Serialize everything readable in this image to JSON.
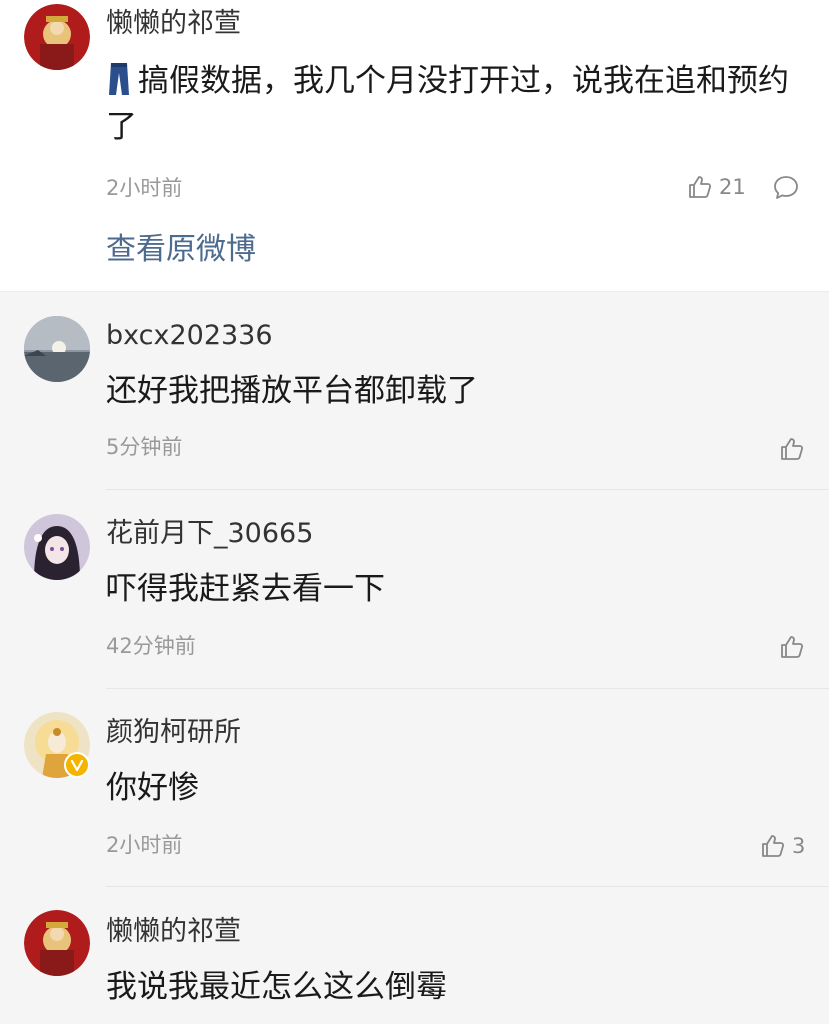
{
  "main_comment": {
    "username": "懒懒的祁萱",
    "emoji_icon": "jeans-icon",
    "text": "搞假数据，我几个月没打开过，说我在追和预约了",
    "time": "2小时前",
    "like_count": "21",
    "view_original_label": "查看原微博"
  },
  "replies": [
    {
      "username": "bxcx202336",
      "text": "还好我把播放平台都卸载了",
      "time": "5分钟前",
      "like_count": ""
    },
    {
      "username": "花前月下_30665",
      "text": "吓得我赶紧去看一下",
      "time": "42分钟前",
      "like_count": ""
    },
    {
      "username": "颜狗柯研所",
      "text": "你好惨",
      "time": "2小时前",
      "like_count": "3",
      "verified": true
    },
    {
      "username": "懒懒的祁萱",
      "text": "我说我最近怎么这么倒霉",
      "time": "",
      "like_count": ""
    }
  ],
  "colors": {
    "link": "#4d6b8f",
    "meta": "#999999",
    "verified_badge": "#f5b400"
  }
}
